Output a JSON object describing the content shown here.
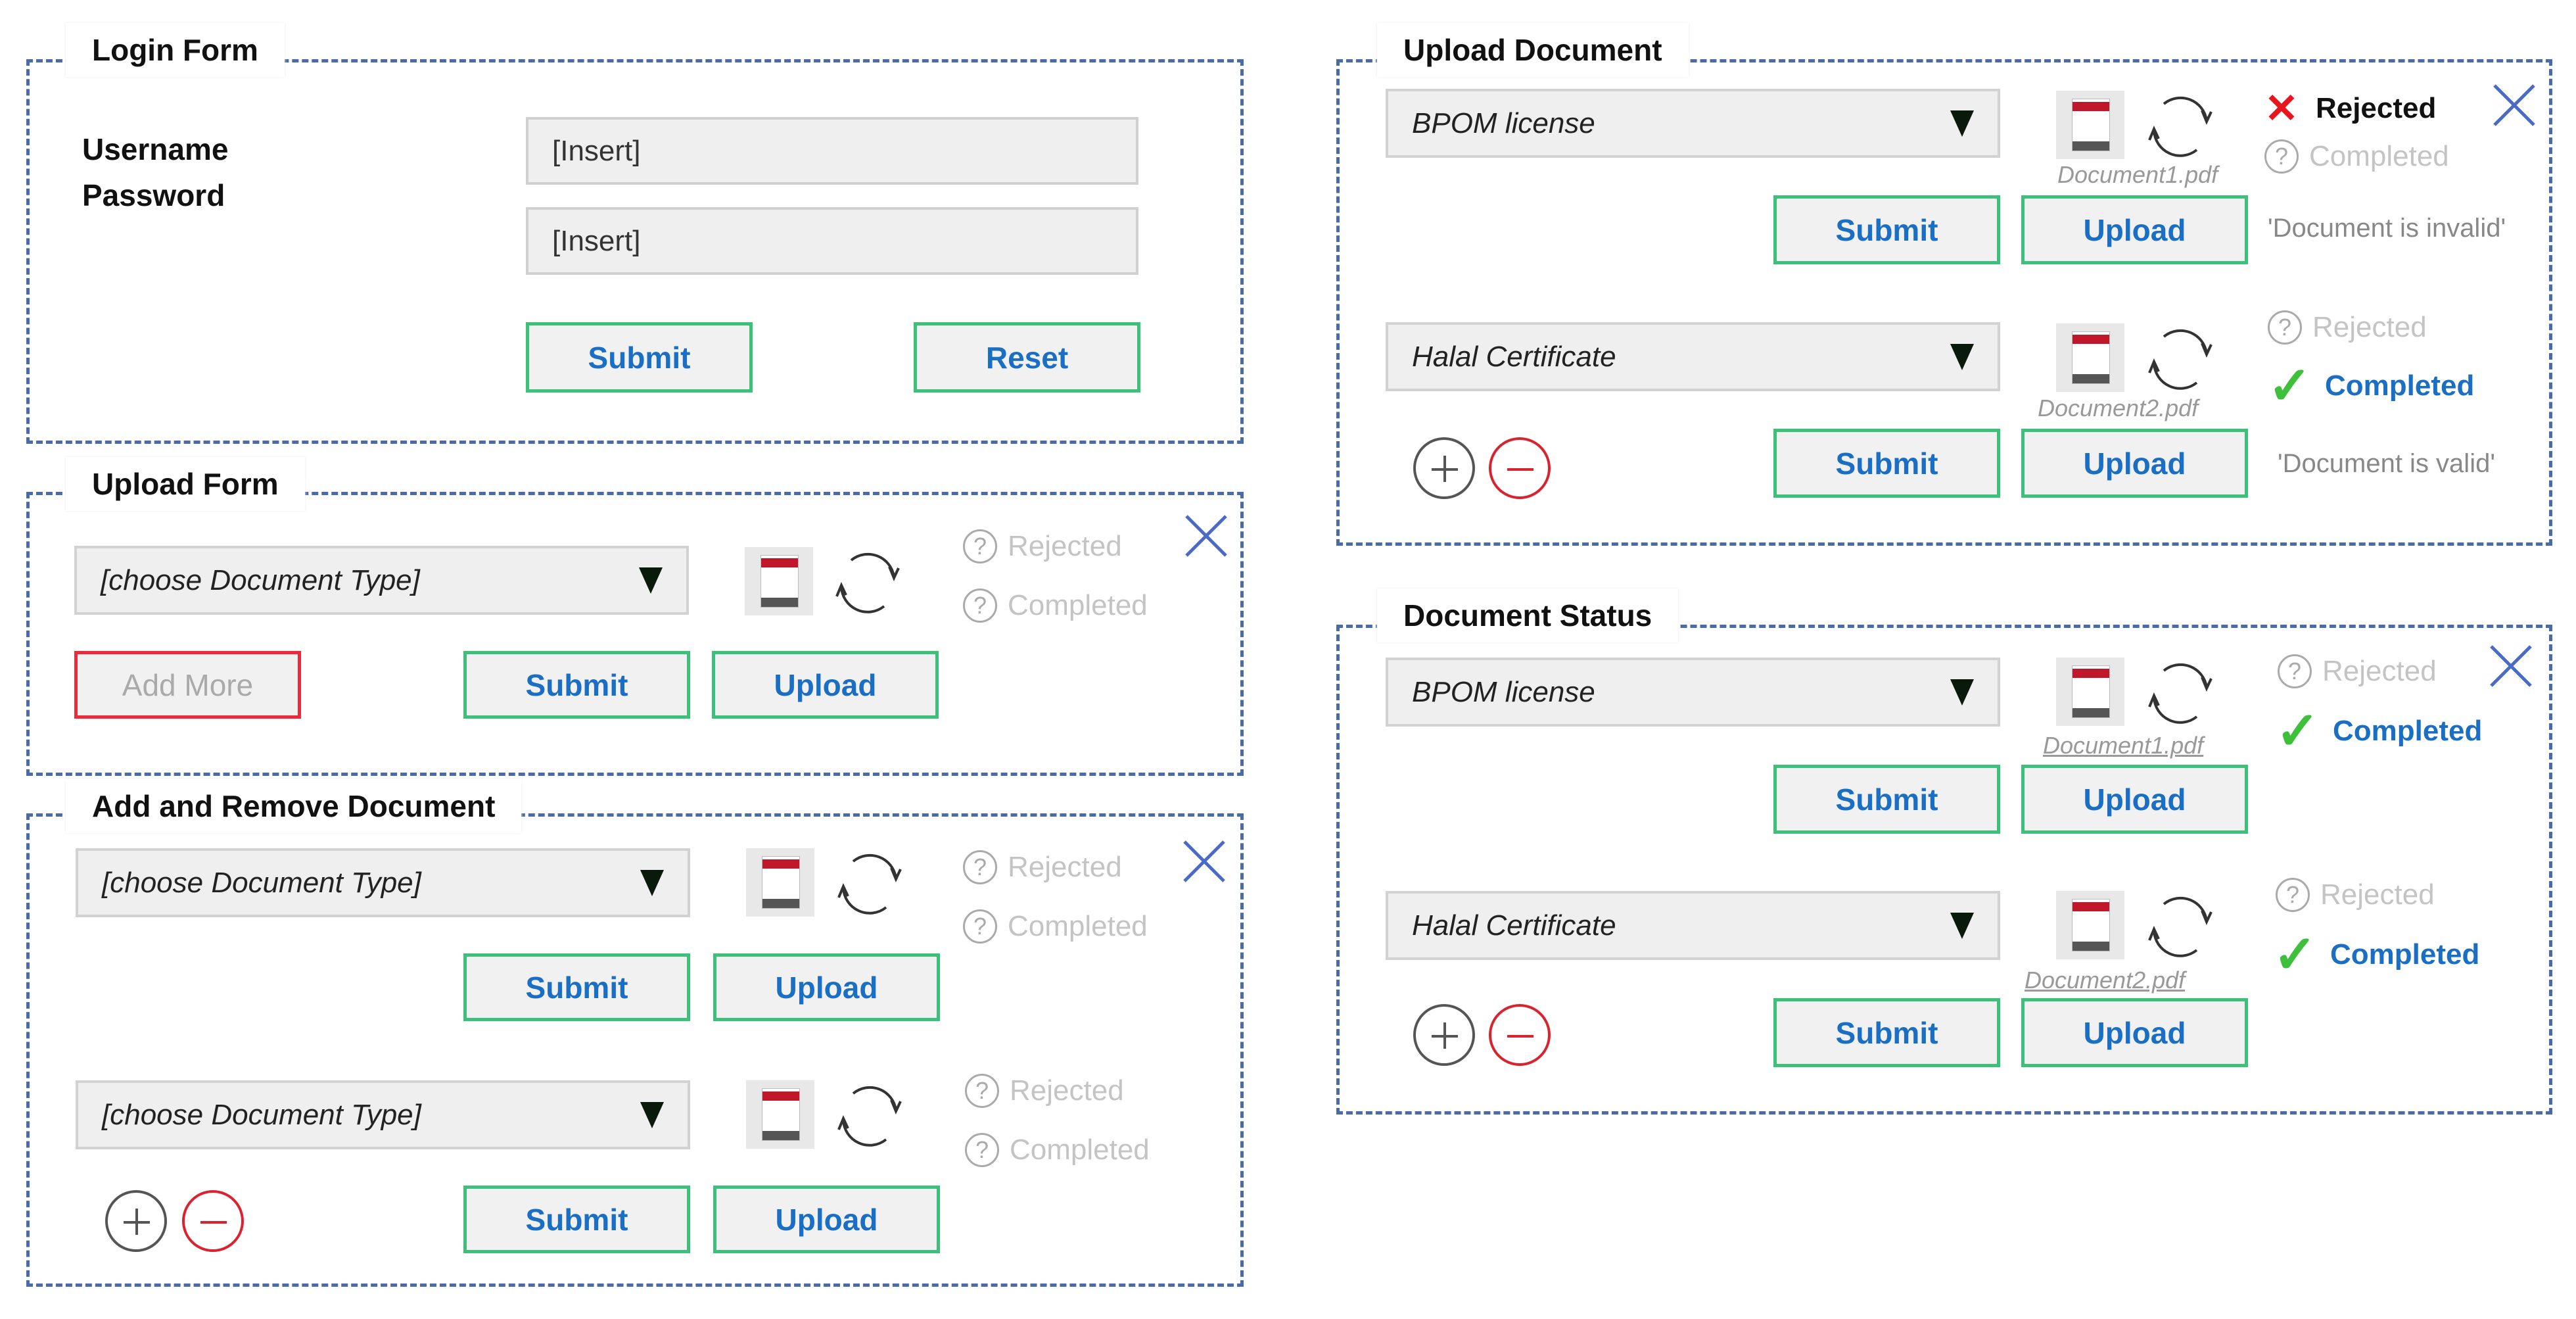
{
  "login_form": {
    "title": "Login Form",
    "username_label": "Username",
    "password_label": "Password",
    "username_value": "[Insert]",
    "password_value": "[Insert]",
    "submit_label": "Submit",
    "reset_label": "Reset"
  },
  "upload_form": {
    "title": "Upload Form",
    "document_type": "[choose Document Type]",
    "status_rejected": "Rejected",
    "status_completed": "Completed",
    "add_more_label": "Add More",
    "submit_label": "Submit",
    "upload_label": "Upload"
  },
  "add_remove_document": {
    "title": "Add and Remove Document",
    "rows": [
      {
        "document_type": "[choose Document Type]",
        "status_rejected": "Rejected",
        "status_completed": "Completed",
        "submit_label": "Submit",
        "upload_label": "Upload"
      },
      {
        "document_type": "[choose Document Type]",
        "status_rejected": "Rejected",
        "status_completed": "Completed",
        "submit_label": "Submit",
        "upload_label": "Upload"
      }
    ]
  },
  "upload_document": {
    "title": "Upload Document",
    "rows": [
      {
        "document_type": "BPOM license",
        "filename": "Document1.pdf",
        "status_rejected": "Rejected",
        "status_completed": "Completed",
        "active_status": "rejected",
        "message": "'Document is invalid'",
        "submit_label": "Submit",
        "upload_label": "Upload"
      },
      {
        "document_type": "Halal Certificate",
        "filename": "Document2.pdf",
        "status_rejected": "Rejected",
        "status_completed": "Completed",
        "active_status": "completed",
        "message": "'Document is valid'",
        "submit_label": "Submit",
        "upload_label": "Upload"
      }
    ]
  },
  "document_status": {
    "title": "Document Status",
    "rows": [
      {
        "document_type": "BPOM license",
        "filename": "Document1.pdf",
        "status_rejected": "Rejected",
        "status_completed": "Completed",
        "active_status": "completed",
        "submit_label": "Submit",
        "upload_label": "Upload"
      },
      {
        "document_type": "Halal Certificate",
        "filename": "Document2.pdf",
        "status_rejected": "Rejected",
        "status_completed": "Completed",
        "active_status": "completed",
        "submit_label": "Submit",
        "upload_label": "Upload"
      }
    ]
  },
  "icons": {
    "status_unknown": "question-circle",
    "status_rejected": "red-x",
    "status_completed": "green-check",
    "close": "blue-x",
    "document": "document-file",
    "refresh": "refresh-arrows",
    "add": "plus-circle",
    "remove": "minus-circle"
  },
  "colors": {
    "panel_border": "#4a6aa8",
    "button_border": "#3cc07a",
    "button_text": "#1a6fc4",
    "add_more_border": "#ee2a3a",
    "rejected_icon": "#e8141e",
    "completed_check": "#3fc03a",
    "close_icon": "#4a6ac8"
  }
}
